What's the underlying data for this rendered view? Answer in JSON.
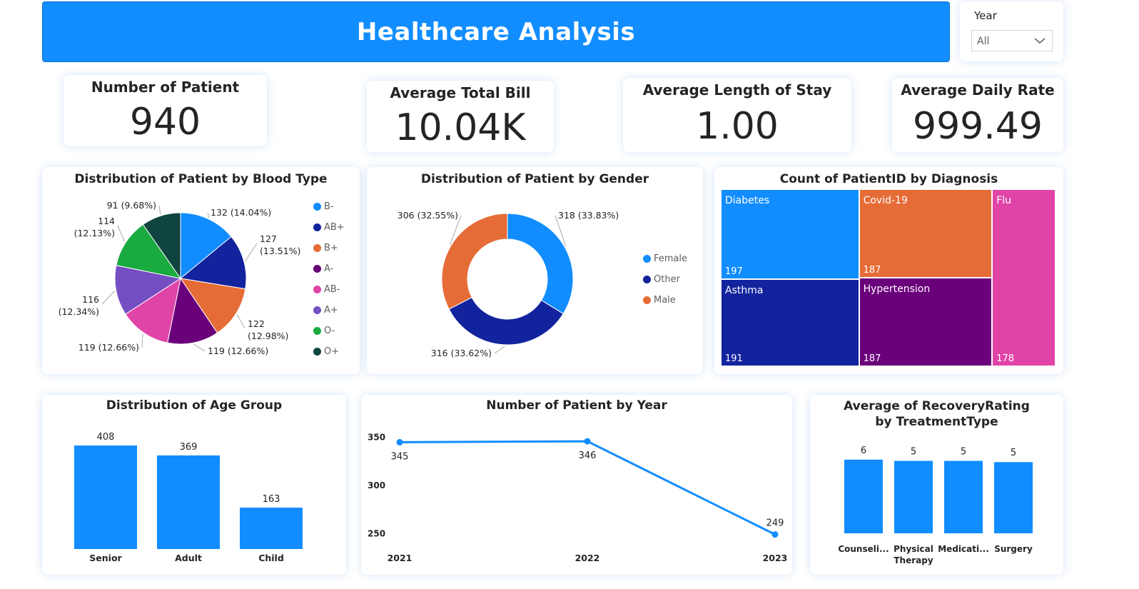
{
  "header": {
    "title": "Healthcare Analysis"
  },
  "slicer": {
    "label": "Year",
    "value": "All"
  },
  "kpis": [
    {
      "label": "Number of Patient",
      "value": "940"
    },
    {
      "label": "Average Total Bill",
      "value": "10.04K"
    },
    {
      "label": "Average Length of Stay",
      "value": "1.00"
    },
    {
      "label": "Average Daily Rate",
      "value": "999.49"
    }
  ],
  "colors": {
    "accent": "#118dff",
    "text": "#252423",
    "muted": "#605e5c"
  },
  "chart_data": [
    {
      "type": "pie",
      "title": "Distribution of Patient by Blood Type",
      "slices": [
        {
          "name": "B-",
          "value": 132,
          "label": "132 (14.04%)",
          "color": "#118dff"
        },
        {
          "name": "AB+",
          "value": 127,
          "label": "127 (13.51%)",
          "color": "#12239e"
        },
        {
          "name": "B+",
          "value": 122,
          "label": "122 (12.98%)",
          "color": "#e66c37"
        },
        {
          "name": "A-",
          "value": 119,
          "label": "119 (12.66%)",
          "color": "#6b007b"
        },
        {
          "name": "AB-",
          "value": 119,
          "label": "119 (12.66%)",
          "color": "#e044a7"
        },
        {
          "name": "A+",
          "value": 116,
          "label": "116 (12.34%)",
          "color": "#744ec2"
        },
        {
          "name": "O-",
          "value": 114,
          "label": "114 (12.13%)",
          "color": "#1aab40"
        },
        {
          "name": "O+",
          "value": 91,
          "label": "91 (9.68%)",
          "color": "#0f4440"
        }
      ],
      "legend": "right"
    },
    {
      "type": "pie",
      "title": "Distribution of Patient by Gender",
      "slices": [
        {
          "name": "Female",
          "value": 318,
          "label": "318 (33.83%)",
          "color": "#118dff"
        },
        {
          "name": "Other",
          "value": 316,
          "label": "316 (33.62%)",
          "color": "#12239e"
        },
        {
          "name": "Male",
          "value": 306,
          "label": "306 (32.55%)",
          "color": "#e66c37"
        }
      ],
      "legend": "right"
    },
    {
      "type": "treemap",
      "title": "Count of PatientID by Diagnosis",
      "items": [
        {
          "name": "Diabetes",
          "value": 197,
          "color": "#118dff"
        },
        {
          "name": "Asthma",
          "value": 191,
          "color": "#12239e"
        },
        {
          "name": "Covid-19",
          "value": 187,
          "color": "#e66c37"
        },
        {
          "name": "Hypertension",
          "value": 187,
          "color": "#6b007b"
        },
        {
          "name": "Flu",
          "value": 178,
          "color": "#e044a7"
        }
      ]
    },
    {
      "type": "bar",
      "title": "Distribution of Age Group",
      "categories": [
        "Senior",
        "Adult",
        "Child"
      ],
      "values": [
        408,
        369,
        163
      ],
      "color": "#118dff"
    },
    {
      "type": "line",
      "title": "Number of Patient by Year",
      "x": [
        "2021",
        "2022",
        "2023"
      ],
      "values": [
        345,
        346,
        249
      ],
      "yticks": [
        250,
        300,
        350
      ],
      "ylim": [
        245,
        352
      ],
      "color": "#118dff"
    },
    {
      "type": "bar",
      "title": "Average of RecoveryRating by TreatmentType",
      "categories": [
        "Counseli...",
        "Physical Therapy",
        "Medicati...",
        "Surgery"
      ],
      "values": [
        6,
        5,
        5,
        5
      ],
      "plotted_values": [
        6,
        5.9,
        5.9,
        5.8
      ],
      "color": "#118dff"
    }
  ]
}
